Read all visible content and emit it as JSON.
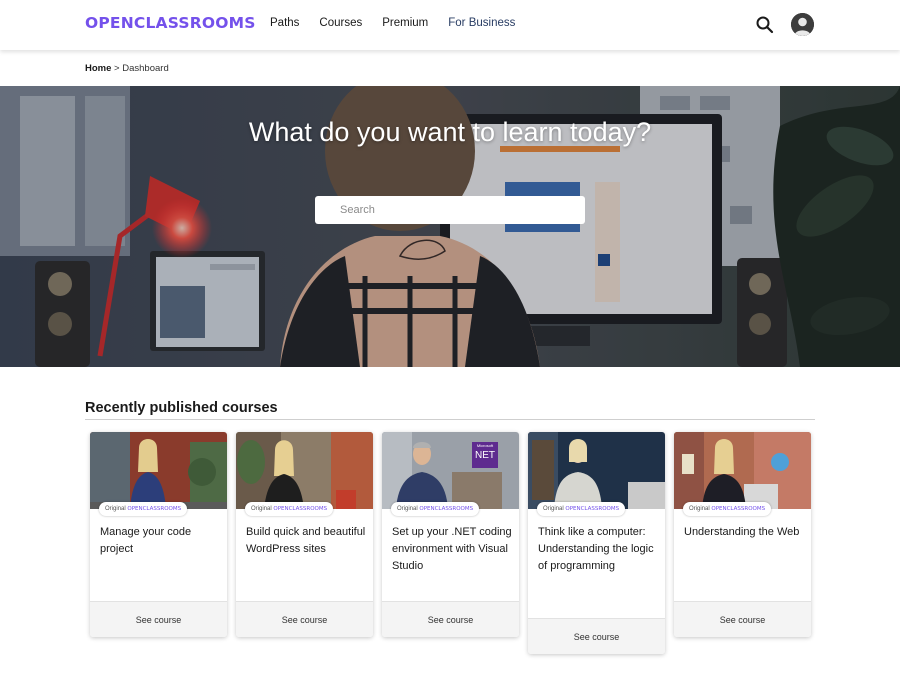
{
  "header": {
    "logo": "OPENCLASSROOMS",
    "nav": [
      "Paths",
      "Courses",
      "Premium",
      "For Business"
    ]
  },
  "breadcrumb": {
    "home": "Home",
    "separator": ">",
    "current": "Dashboard"
  },
  "hero": {
    "title": "What do you want to learn today?",
    "search_placeholder": "Search"
  },
  "section": {
    "title": "Recently published courses"
  },
  "courses": [
    {
      "badge_prefix": "Original",
      "badge_brand": "OPENCLASSROOMS",
      "title": "Manage your code project",
      "action": "See course"
    },
    {
      "badge_prefix": "Original",
      "badge_brand": "OPENCLASSROOMS",
      "title": "Build quick and beautiful WordPress sites",
      "action": "See course"
    },
    {
      "badge_prefix": "Original",
      "badge_brand": "OPENCLASSROOMS",
      "title": "Set up your .NET coding environment with Visual Studio",
      "action": "See course",
      "thumb_logo_small": "Microsoft",
      "thumb_logo": "NET"
    },
    {
      "badge_prefix": "Original",
      "badge_brand": "OPENCLASSROOMS",
      "title": "Think like a computer: Understanding the logic of programming",
      "action": "See course"
    },
    {
      "badge_prefix": "Original",
      "badge_brand": "OPENCLASSROOMS",
      "title": "Understanding the Web",
      "action": "See course"
    }
  ],
  "colors": {
    "brand": "#7451eb",
    "business_link": "#283c63"
  }
}
